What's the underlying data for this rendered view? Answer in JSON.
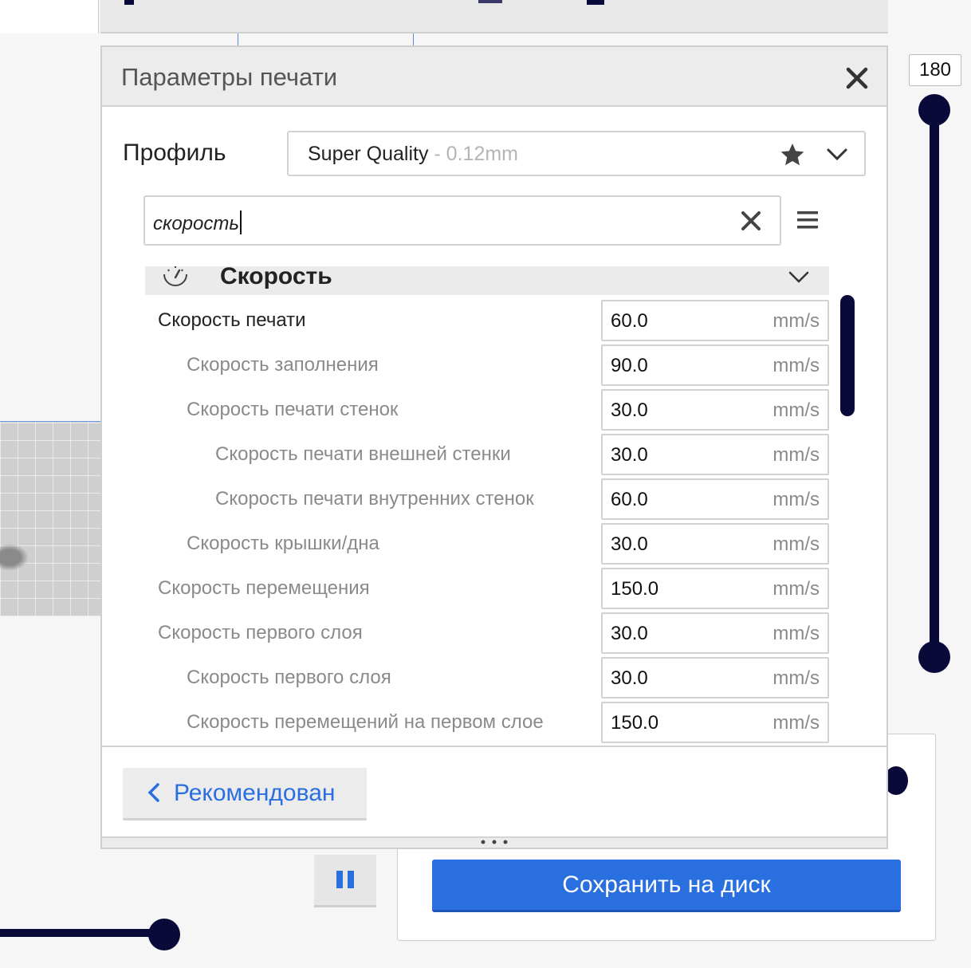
{
  "scene": {
    "layer_slider_value": "180",
    "save_button_label": "Сохранить на диск"
  },
  "panel": {
    "title": "Параметры печати",
    "profile_label": "Профиль",
    "profile_name": "Super Quality",
    "profile_detail": " - 0.12mm",
    "search_value": "скорость",
    "category": "Скорость",
    "rows": [
      {
        "label": "Скорость печати",
        "value": "60.0",
        "unit": "mm/s"
      },
      {
        "label": "Скорость заполнения",
        "value": "90.0",
        "unit": "mm/s"
      },
      {
        "label": "Скорость печати стенок",
        "value": "30.0",
        "unit": "mm/s"
      },
      {
        "label": "Скорость печати внешней стенки",
        "value": "30.0",
        "unit": "mm/s"
      },
      {
        "label": "Скорость печати внутренних стенок",
        "value": "60.0",
        "unit": "mm/s"
      },
      {
        "label": "Скорость крышки/дна",
        "value": "30.0",
        "unit": "mm/s"
      },
      {
        "label": "Скорость перемещения",
        "value": "150.0",
        "unit": "mm/s"
      },
      {
        "label": "Скорость первого слоя",
        "value": "30.0",
        "unit": "mm/s"
      },
      {
        "label": "Скорость первого слоя",
        "value": "30.0",
        "unit": "mm/s"
      },
      {
        "label": "Скорость перемещений на первом слое",
        "value": "150.0",
        "unit": "mm/s"
      }
    ],
    "recommended_label": "Рекомендован"
  },
  "colors": {
    "accent": "#2a6fe0",
    "dark_navy": "#0a0a3a"
  },
  "icons": {
    "close": "close-icon",
    "favorite": "star-icon",
    "dropdown": "chevron-down-icon",
    "search_clear": "clear-icon",
    "settings_menu": "hamburger-menu-icon",
    "category": "speedometer-icon",
    "back": "chevron-left-icon",
    "pause": "pause-icon"
  }
}
